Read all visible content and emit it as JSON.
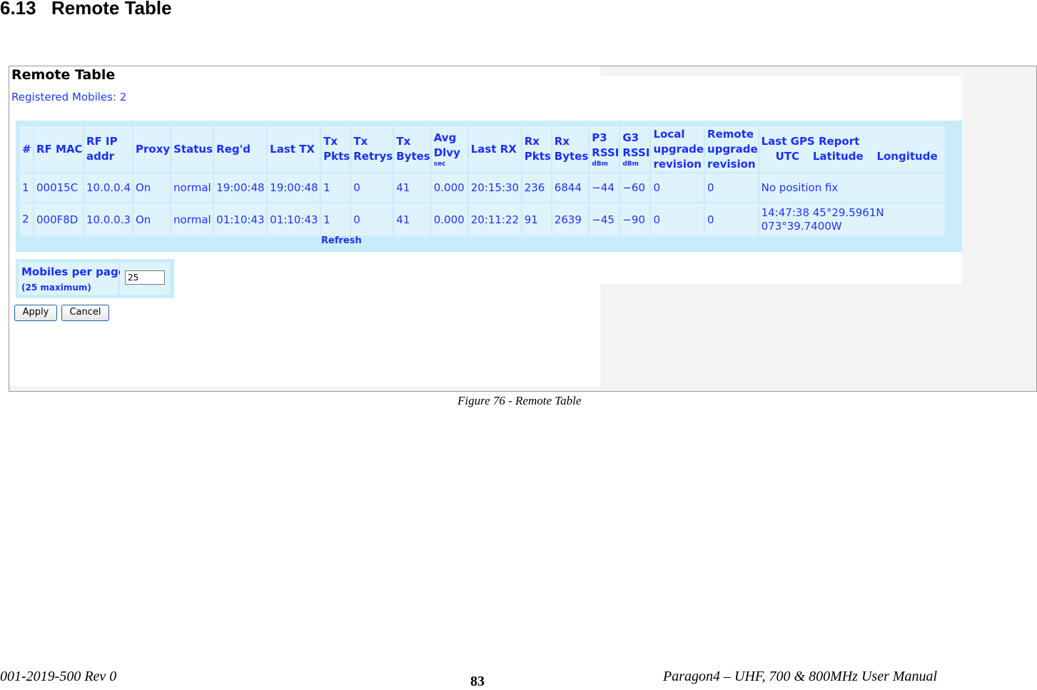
{
  "section": {
    "number": "6.13",
    "title": "Remote Table"
  },
  "ui": {
    "title": "Remote Table",
    "registered": "Registered Mobiles: 2",
    "columns": {
      "num": "#",
      "rf_mac": "RF MAC",
      "rf_ip": [
        "RF IP",
        "addr"
      ],
      "proxy": "Proxy",
      "status": "Status",
      "regd": "Reg'd",
      "last_tx": "Last TX",
      "tx_pkts": [
        "Tx",
        "Pkts"
      ],
      "tx_retrys": [
        "Tx",
        "Retrys"
      ],
      "tx_bytes": [
        "Tx",
        "Bytes"
      ],
      "avg_dlvy": [
        "Avg",
        "Dlvy",
        "sec"
      ],
      "last_rx": "Last RX",
      "rx_pkts": [
        "Rx",
        "Pkts"
      ],
      "rx_bytes": [
        "Rx",
        "Bytes"
      ],
      "p3_rssi": [
        "P3",
        "RSSI",
        "dBm"
      ],
      "g3_rssi": [
        "G3",
        "RSSI",
        "dBm"
      ],
      "local_upgrade": [
        "Local",
        "upgrade",
        "revision"
      ],
      "remote_upgrade": [
        "Remote",
        "upgrade",
        "revision"
      ],
      "gps": {
        "title": "Last GPS Report",
        "utc": "UTC",
        "latitude": "Latitude",
        "longitude": "Longitude"
      }
    },
    "rows": [
      [
        "1",
        "00015C",
        "10.0.0.4",
        "On",
        "normal",
        "19:00:48",
        "19:00:48",
        "1",
        "0",
        "41",
        "0.000",
        "20:15:30",
        "236",
        "6844",
        "−44",
        "−60",
        "0",
        "0",
        "No position fix"
      ],
      [
        "2",
        "000F8D",
        "10.0.0.3",
        "On",
        "normal",
        "01:10:43",
        "01:10:43",
        "1",
        "0",
        "41",
        "0.000",
        "20:11:22",
        "91",
        "2639",
        "−45",
        "−90",
        "0",
        "0",
        "14:47:38 45°29.5961N 073°39.7400W"
      ]
    ],
    "refresh": "Refresh",
    "mobiles_per_page": {
      "label": "Mobiles per page",
      "note": "(25 maximum)",
      "value": "25"
    },
    "buttons": {
      "apply": "Apply",
      "cancel": "Cancel"
    }
  },
  "caption": "Figure 76 - Remote Table",
  "footer": {
    "left": "001-2019-500 Rev 0",
    "page": "83",
    "right": "Paragon4 – UHF, 700  & 800MHz User Manual"
  }
}
